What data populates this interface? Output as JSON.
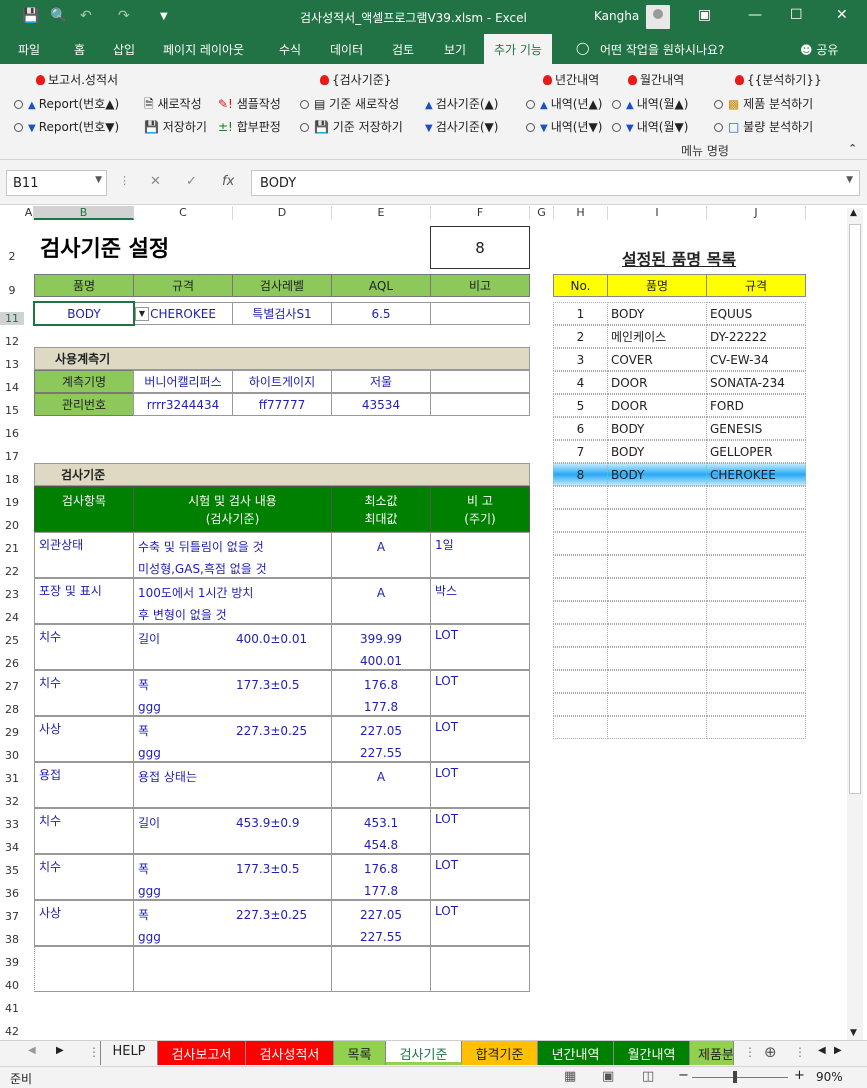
{
  "window": {
    "title": "검사성적서_액셀프로그램V39.xlsm  -  Excel",
    "user": "Kangha"
  },
  "tabs": [
    "파일",
    "홈",
    "삽입",
    "페이지 레이아웃",
    "수식",
    "데이터",
    "검토",
    "보기",
    "추가 기능",
    "어떤 작업을 원하시나요?",
    "공유"
  ],
  "ribbon": {
    "g1_title": "보고서.성적서",
    "report_up": "Report(번호▲)",
    "report_down": "Report(번호▼)",
    "new": "새로작성",
    "save": "저장하기",
    "sample": "샘플작성",
    "judge": "합부판정",
    "g2_title": "{검사기준}",
    "std_new": "기준 새로작성",
    "std_save": "기준 저장하기",
    "std_up": "검사기준(▲)",
    "std_down": "검사기준(▼)",
    "g3_title": "년간내역",
    "y_up": "내역(년▲)",
    "y_down": "내역(년▼)",
    "g4_title": "월간내역",
    "m_up": "내역(월▲)",
    "m_down": "내역(월▼)",
    "g5_title": "{{분석하기}}",
    "prod": "제품 분석하기",
    "defect": "불량 분석하기",
    "caption": "메뉴 명령"
  },
  "formula": {
    "namebox": "B11",
    "value": "BODY"
  },
  "columns": [
    "A",
    "B",
    "C",
    "D",
    "E",
    "F",
    "G",
    "H",
    "I",
    "J"
  ],
  "rows": [
    "2",
    "9",
    "11",
    "12",
    "13",
    "14",
    "15",
    "16",
    "17",
    "18",
    "19",
    "20",
    "21",
    "22",
    "23",
    "24",
    "25",
    "26",
    "27",
    "28",
    "29",
    "30",
    "31",
    "32",
    "33",
    "34",
    "35",
    "36",
    "37",
    "38",
    "39",
    "40",
    "41",
    "42"
  ],
  "sheet": {
    "title": "검사기준 설정",
    "number": "8",
    "header": [
      "품명",
      "규격",
      "검사레벨",
      "AQL",
      "비고"
    ],
    "row11": [
      "BODY",
      "CHEROKEE",
      "특별검사S1",
      "6.5",
      ""
    ],
    "meter_title": "사용계측기",
    "meter_rows": [
      [
        "계측기명",
        "버니어캘리퍼스",
        "하이트게이지",
        "저울"
      ],
      [
        "관리번호",
        "rrrr3244434",
        "ff77777",
        "43534"
      ]
    ],
    "std_title": "검사기준",
    "std_header": [
      "검사항목",
      "시험 및 검사 내용",
      "(검사기준)",
      "최소값",
      "최대값",
      "비  고",
      "(주기)"
    ],
    "std_rows": [
      {
        "item": "외관상태",
        "c1": "수축 및 뒤틀림이 없을 것",
        "c2": "미성형,GAS,흑점 없을 것",
        "spec": "",
        "min": "A",
        "max": "",
        "note": "1일"
      },
      {
        "item": "포장 및 표시",
        "c1": "100도에서 1시간 방치",
        "c2": "후 변형이 없을 것",
        "spec": "",
        "min": "A",
        "max": "",
        "note": "박스"
      },
      {
        "item": "치수",
        "c1": "길이",
        "c2": "",
        "spec": "400.0±0.01",
        "min": "399.99",
        "max": "400.01",
        "note": "LOT"
      },
      {
        "item": "치수",
        "c1": "폭",
        "c2": "ggg",
        "spec": "177.3±0.5",
        "min": "176.8",
        "max": "177.8",
        "note": "LOT"
      },
      {
        "item": "사상",
        "c1": "폭",
        "c2": "ggg",
        "spec": "227.3±0.25",
        "min": "227.05",
        "max": "227.55",
        "note": "LOT"
      },
      {
        "item": "용접",
        "c1": "용접 상태는",
        "c2": "",
        "spec": "",
        "min": "A",
        "max": "",
        "note": "LOT"
      },
      {
        "item": "치수",
        "c1": "길이",
        "c2": "",
        "spec": "453.9±0.9",
        "min": "453.1",
        "max": "454.8",
        "note": "LOT"
      },
      {
        "item": "치수",
        "c1": "폭",
        "c2": "ggg",
        "spec": "177.3±0.5",
        "min": "176.8",
        "max": "177.8",
        "note": "LOT"
      },
      {
        "item": "사상",
        "c1": "폭",
        "c2": "ggg",
        "spec": "227.3±0.25",
        "min": "227.05",
        "max": "227.55",
        "note": "LOT"
      }
    ],
    "list_title": "설정된 품명 목록",
    "list_header": [
      "No.",
      "품명",
      "규격"
    ],
    "list": [
      [
        "1",
        "BODY",
        "EQUUS"
      ],
      [
        "2",
        "메인케이스",
        "DY-22222"
      ],
      [
        "3",
        "COVER",
        "CV-EW-34"
      ],
      [
        "4",
        "DOOR",
        "SONATA-234"
      ],
      [
        "5",
        "DOOR",
        "FORD"
      ],
      [
        "6",
        "BODY",
        "GENESIS"
      ],
      [
        "7",
        "BODY",
        "GELLOPER"
      ],
      [
        "8",
        "BODY",
        "CHEROKEE"
      ]
    ]
  },
  "sheet_tabs": [
    "HELP",
    "검사보고서",
    "검사성적서",
    "목록",
    "검사기준",
    "합격기준",
    "년간내역",
    "월간내역",
    "제품분"
  ],
  "status": {
    "ready": "준비",
    "zoom": "90%"
  },
  "colors": {
    "accent": "#217346",
    "green": "#8cc95a",
    "dark_green": "#008000",
    "beige": "#ddd9c3",
    "yellow": "#ffff00",
    "blue_text": "#1f1fb4"
  }
}
